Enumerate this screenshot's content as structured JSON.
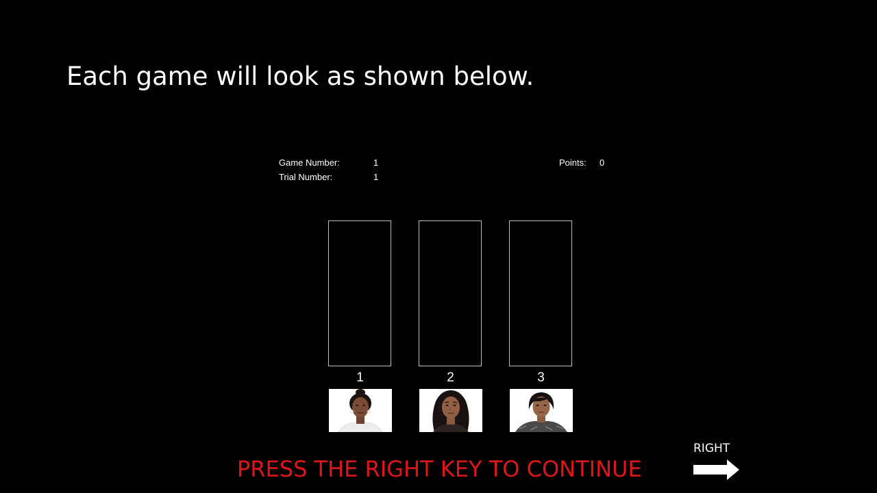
{
  "instruction": {
    "text": "Each game will look as shown below."
  },
  "status": {
    "game_number_label": "Game Number:",
    "game_number_value": "1",
    "trial_number_label": "Trial Number:",
    "trial_number_value": "1",
    "points_label": "Points:",
    "points_value": "0"
  },
  "decks": [
    {
      "number": "1",
      "face": "face-photo-curly-bun-hair"
    },
    {
      "number": "2",
      "face": "face-photo-long-wavy-hair"
    },
    {
      "number": "3",
      "face": "face-photo-short-dark-hair"
    }
  ],
  "prompt": {
    "text": "PRESS THE RIGHT KEY TO CONTINUE",
    "color": "#e01616"
  },
  "key_hint": {
    "label": "RIGHT",
    "icon": "right-arrow-icon"
  }
}
